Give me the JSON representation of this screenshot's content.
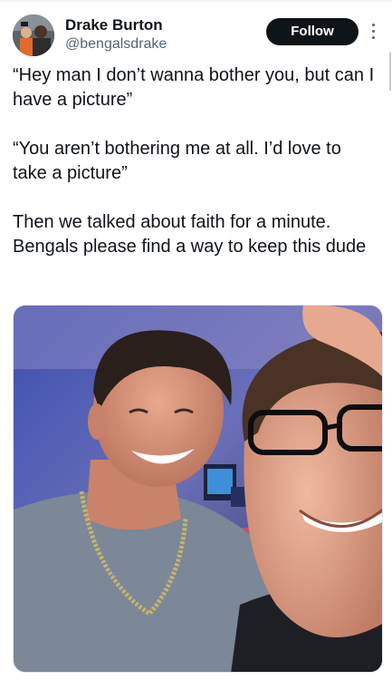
{
  "tweet": {
    "author": {
      "display_name": "Drake Burton",
      "handle": "@bengalsdrake"
    },
    "follow_label": "Follow",
    "text_paragraphs": [
      "“Hey man I don’t wanna bother you, but can I have a picture”",
      "“You aren’t bothering me at all. I’d love to take a picture”",
      "Then we talked about faith for a minute. Bengals please find a way to keep this dude"
    ]
  },
  "icons": {
    "more": "more-options-icon",
    "avatar": "avatar-image"
  },
  "colors": {
    "text_primary": "#0f1419",
    "text_secondary": "#536471",
    "follow_bg": "#0f1419",
    "follow_text": "#ffffff"
  }
}
